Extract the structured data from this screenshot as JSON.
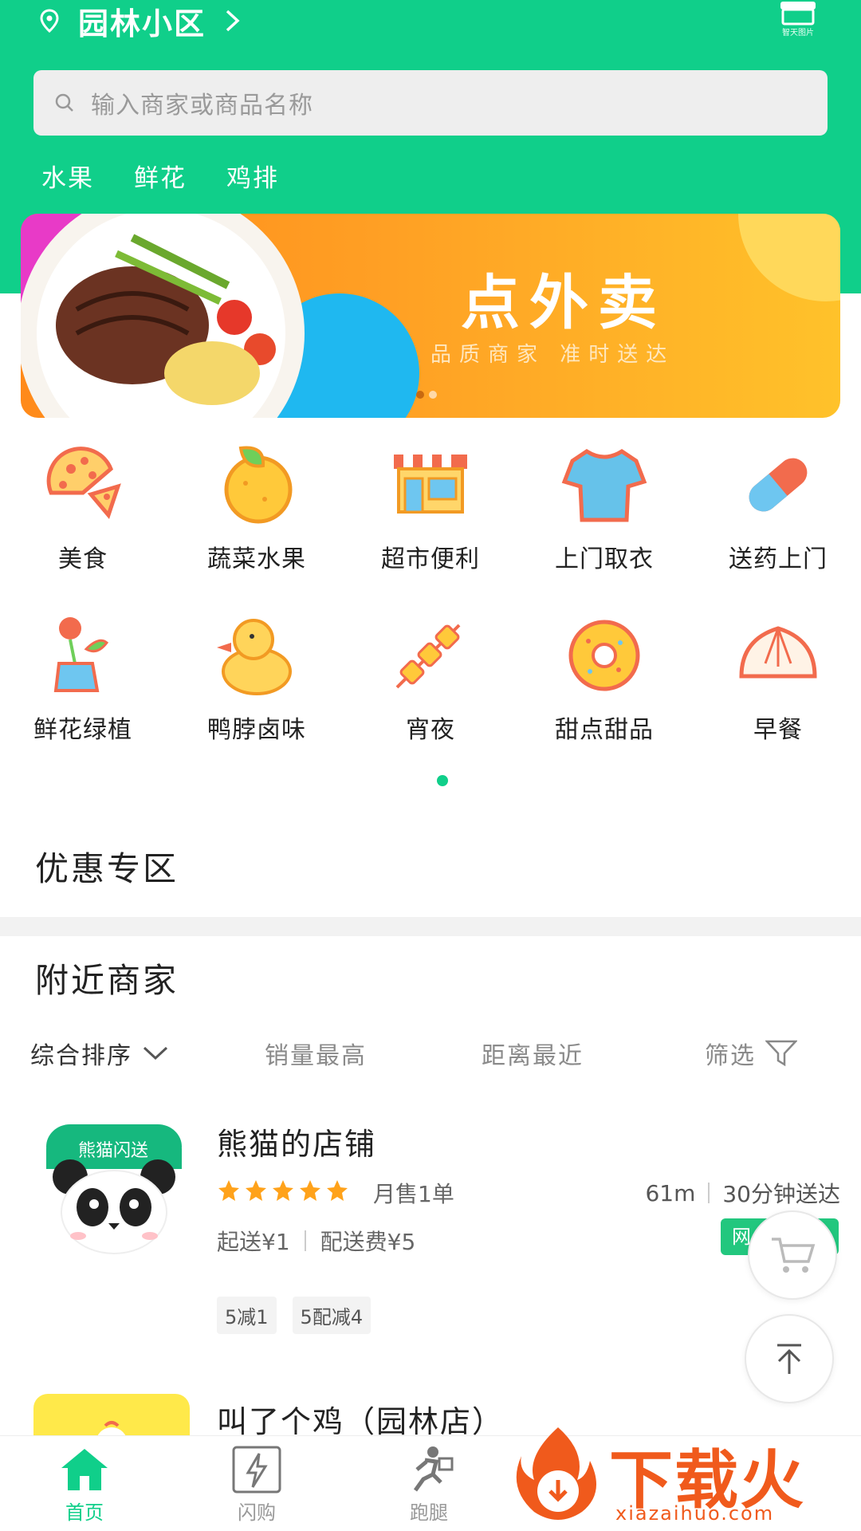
{
  "header": {
    "location": "园林小区",
    "shop_caption": "智天图片"
  },
  "search": {
    "placeholder": "输入商家或商品名称"
  },
  "hot_tags": [
    "水果",
    "鲜花",
    "鸡排"
  ],
  "banner": {
    "title": "点外卖",
    "subtitle": "品质商家 准时送达",
    "pages": 2,
    "active_page": 1
  },
  "categories": [
    {
      "label": "美食",
      "icon": "pizza-icon"
    },
    {
      "label": "蔬菜水果",
      "icon": "orange-icon"
    },
    {
      "label": "超市便利",
      "icon": "store-icon"
    },
    {
      "label": "上门取衣",
      "icon": "tshirt-icon"
    },
    {
      "label": "送药上门",
      "icon": "pill-icon"
    },
    {
      "label": "鲜花绿植",
      "icon": "flower-icon"
    },
    {
      "label": "鸭脖卤味",
      "icon": "duck-icon"
    },
    {
      "label": "宵夜",
      "icon": "skewer-icon"
    },
    {
      "label": "甜点甜品",
      "icon": "donut-icon"
    },
    {
      "label": "早餐",
      "icon": "bun-icon"
    }
  ],
  "sections": {
    "promo_title": "优惠专区",
    "nearby_title": "附近商家"
  },
  "sort_bar": {
    "default": "综合排序",
    "sales": "销量最高",
    "distance": "距离最近",
    "filter": "筛选"
  },
  "stores": [
    {
      "name": "熊猫的店铺",
      "logo_text": "熊猫闪送",
      "rating": 5,
      "monthly_sales": "月售1单",
      "distance": "61m",
      "delivery_time": "30分钟送达",
      "min_order": "起送¥1",
      "delivery_fee": "配送费¥5",
      "badge": "网",
      "promos": [
        "5减1",
        "5配减4"
      ]
    },
    {
      "name": "叫了个鸡（园林店）"
    }
  ],
  "tabbar": [
    {
      "label": "首页",
      "icon": "home-icon",
      "active": true
    },
    {
      "label": "闪购",
      "icon": "flash-buy-icon",
      "active": false
    },
    {
      "label": "跑腿",
      "icon": "runner-icon",
      "active": false
    }
  ],
  "watermark": {
    "text": "下载火",
    "url": "xiazaihuo.com"
  },
  "colors": {
    "primary": "#10cf8a",
    "banner_orange": "#ff9a22",
    "star": "#ffa21a",
    "watermark": "#f05a1c"
  }
}
